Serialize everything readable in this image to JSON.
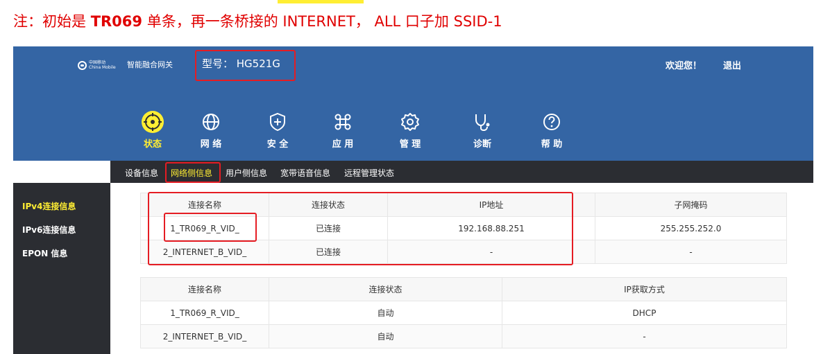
{
  "note": {
    "prefix": "注：初始是 ",
    "bold": "TR069",
    "mid1": " 单条，再一条桥接的 ",
    "internet": "INTERNET",
    "mid2": "， ",
    "all": "ALL",
    "mid3": " 口子加 ",
    "ssid": "SSID-1"
  },
  "header": {
    "logo_text": "中国移动",
    "logo_text_en": "China Mobile",
    "gateway_name": "智能融合网关",
    "model": "型号： HG521G",
    "welcome": "欢迎您！",
    "logout": "退出"
  },
  "nav": [
    {
      "label": "状态",
      "icon": "status-target-icon",
      "active": true
    },
    {
      "label": "网 络",
      "icon": "globe-icon",
      "active": false
    },
    {
      "label": "安 全",
      "icon": "shield-plus-icon",
      "active": false
    },
    {
      "label": "应 用",
      "icon": "command-key-icon",
      "active": false
    },
    {
      "label": "管 理",
      "icon": "gear-icon",
      "active": false
    },
    {
      "label": "诊断",
      "icon": "stethoscope-icon",
      "active": false
    },
    {
      "label": "帮 助",
      "icon": "question-circle-icon",
      "active": false
    }
  ],
  "subnav": [
    "设备信息",
    "网络侧信息",
    "用户侧信息",
    "宽带语音信息",
    "远程管理状态"
  ],
  "left_menu": [
    "IPv4连接信息",
    "IPv6连接信息",
    "EPON 信息"
  ],
  "table1": {
    "headers": [
      "连接名称",
      "连接状态",
      "IP地址",
      "子网掩码"
    ],
    "rows": [
      [
        "1_TR069_R_VID_",
        "已连接",
        "192.168.88.251",
        "255.255.252.0"
      ],
      [
        "2_INTERNET_B_VID_",
        "已连接",
        "-",
        "-"
      ]
    ]
  },
  "table2": {
    "headers": [
      "连接名称",
      "连接状态",
      "IP获取方式"
    ],
    "rows": [
      [
        "1_TR069_R_VID_",
        "自动",
        "DHCP"
      ],
      [
        "2_INTERNET_B_VID_",
        "自动",
        "-"
      ]
    ]
  },
  "colors": {
    "header_bg": "#3465a4",
    "dark_bg": "#2b2d32",
    "accent_yellow": "#ffee33",
    "annotation_red": "#e51c23"
  }
}
